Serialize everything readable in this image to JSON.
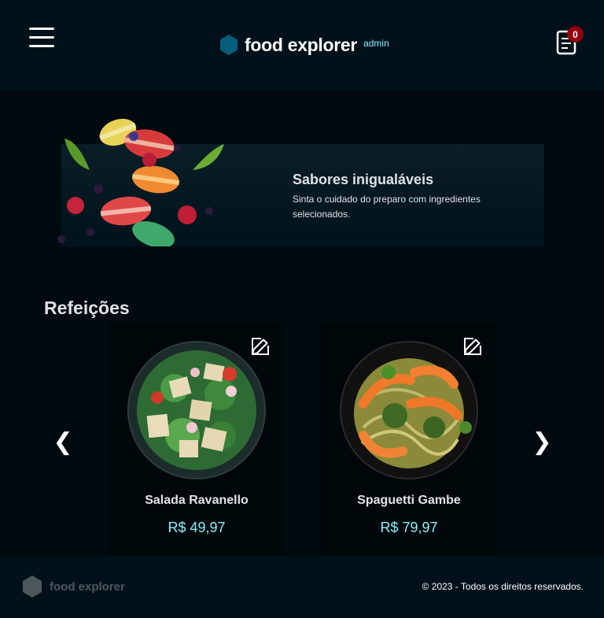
{
  "header": {
    "brand_name": "food explorer",
    "role_badge": "admin",
    "cart_count": "0"
  },
  "banner": {
    "title": "Sabores inigualáveis",
    "text": "Sinta o cuidado do preparo com ingredientes selecionados."
  },
  "section": {
    "title": "Refeições"
  },
  "dishes": [
    {
      "name": "Salada Ravanello",
      "price": "R$ 49,97",
      "image": "salad"
    },
    {
      "name": "Spaguetti Gambe",
      "price": "R$ 79,97",
      "image": "shrimp-pasta"
    }
  ],
  "carousel": {
    "prev_label": "❮",
    "next_label": "❯"
  },
  "footer": {
    "brand_name": "food explorer",
    "copyright": "© 2023 - Todos os direitos reservados."
  },
  "colors": {
    "background": "#000a0f",
    "header": "#00111a",
    "accent": "#82f3ff",
    "logo": "#065e7c",
    "badge": "#92000e"
  },
  "icons": {
    "menu": "menu-icon",
    "cart": "receipt-icon",
    "edit": "pencil-icon",
    "logo": "hexagon-icon"
  }
}
